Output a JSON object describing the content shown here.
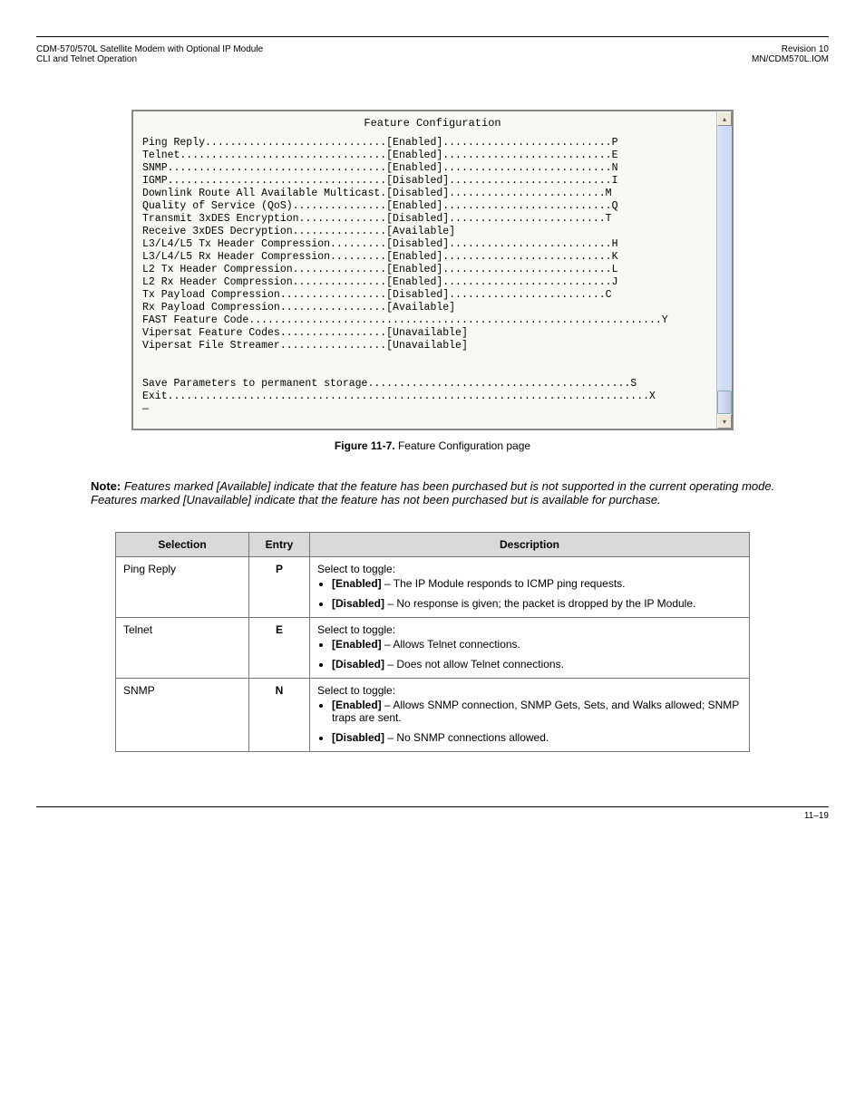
{
  "header": {
    "left": "CDM-570/570L Satellite Modem with Optional IP Module",
    "right": "Revision 10",
    "left2": "CLI and Telnet Operation",
    "right2": "MN/CDM570L.IOM"
  },
  "screenshot": {
    "title": "Feature Configuration",
    "lines": [
      "Ping Reply.............................[Enabled]...........................P",
      "Telnet.................................[Enabled]...........................E",
      "SNMP...................................[Enabled]...........................N",
      "IGMP...................................[Disabled]..........................I",
      "Downlink Route All Available Multicast.[Disabled].........................M",
      "Quality of Service (QoS)...............[Enabled]...........................Q",
      "Transmit 3xDES Encryption..............[Disabled].........................T",
      "Receive 3xDES Decryption...............[Available]",
      "L3/L4/L5 Tx Header Compression.........[Disabled]..........................H",
      "L3/L4/L5 Rx Header Compression.........[Enabled]...........................K",
      "L2 Tx Header Compression...............[Enabled]...........................L",
      "L2 Rx Header Compression...............[Enabled]...........................J",
      "Tx Payload Compression.................[Disabled].........................C",
      "Rx Payload Compression.................[Available]",
      "FAST Feature Code..................................................................Y",
      "Vipersat Feature Codes.................[Unavailable]",
      "Vipersat File Streamer.................[Unavailable]",
      "",
      "",
      "Save Parameters to permanent storage..........................................S",
      "Exit.............................................................................X",
      "—"
    ]
  },
  "caption": {
    "num": "Figure 11-7.",
    "text": " Feature Configuration page"
  },
  "note_label": "Note:",
  "note_text": " Features marked [Available] indicate that the feature has been purchased but is not supported in the current operating mode. Features marked [Unavailable] indicate that the feature has not been purchased but is available for purchase.",
  "table": {
    "headers": [
      "Selection",
      "Entry",
      "Description"
    ],
    "rows": [
      {
        "sel": "Ping Reply",
        "entry": "P",
        "desc_intro": "Select to toggle:",
        "items": [
          {
            "lead": "[Enabled]",
            "rest": " – The IP Module responds to ICMP ping requests."
          },
          {
            "lead": "[Disabled]",
            "rest": " – No response is given; the packet is dropped by the IP Module."
          }
        ]
      },
      {
        "sel": "Telnet",
        "entry": "E",
        "desc_intro": "Select to toggle:",
        "items": [
          {
            "lead": "[Enabled]",
            "rest": " – Allows Telnet connections."
          },
          {
            "lead": "[Disabled]",
            "rest": " – Does not allow Telnet connections."
          }
        ]
      },
      {
        "sel": "SNMP",
        "entry": "N",
        "desc_intro": "Select to toggle:",
        "items": [
          {
            "lead": "[Enabled]",
            "rest": " – Allows SNMP connection, SNMP Gets, Sets, and Walks allowed; SNMP traps are sent."
          },
          {
            "lead": "[Disabled]",
            "rest": " – No SNMP connections allowed."
          }
        ]
      }
    ]
  },
  "footer": {
    "page": "11–19"
  }
}
